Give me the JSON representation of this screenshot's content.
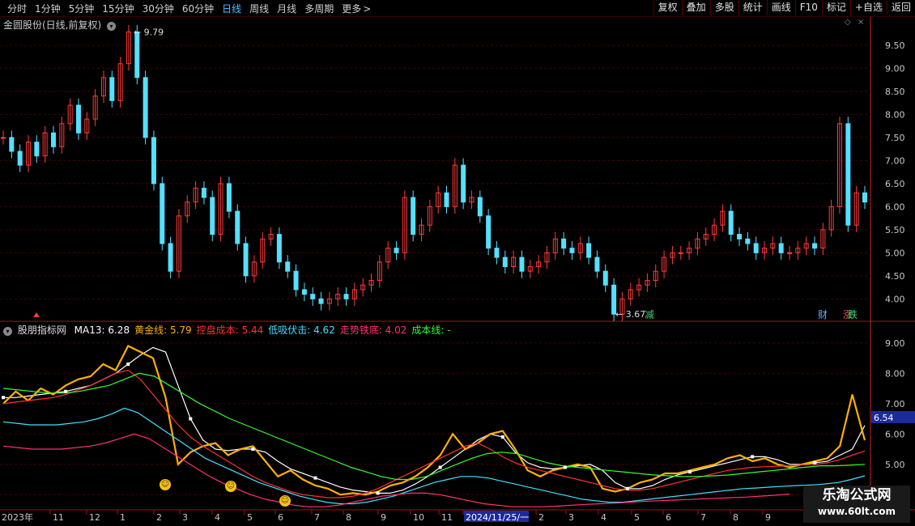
{
  "toolbar": {
    "periods": [
      "分时",
      "1分钟",
      "5分钟",
      "15分钟",
      "30分钟",
      "60分钟",
      "日线",
      "周线",
      "月线",
      "多周期",
      "更多"
    ],
    "active_period": "日线",
    "more_chevron_icon": "chevron-right-icon",
    "tools": [
      "复权",
      "叠加",
      "多股",
      "统计",
      "画线",
      "F10",
      "标记",
      "+自选",
      "返回"
    ]
  },
  "main_panel": {
    "title": "金圆股份(日线,前复权)",
    "high_label": "9.79",
    "low_label": "3.67",
    "markers": {
      "jian": "减",
      "cai": "财",
      "zhang": "涨",
      "die": "跌"
    },
    "colors": {
      "up": "#ff3b3b",
      "down": "#54e0ff",
      "grid": "#4a0000",
      "axis": "#cc2222"
    }
  },
  "indicator_panel": {
    "title": "股朋指标网",
    "items": [
      {
        "label": "MA13: 6.28",
        "color": "#ffffff"
      },
      {
        "label": "黄金线: 5.79",
        "color": "#ffb000"
      },
      {
        "label": "控盘成本: 5.44",
        "color": "#ff3030"
      },
      {
        "label": "低吸伏击: 4.62",
        "color": "#40e0ff"
      },
      {
        "label": "走势铁底: 4.02",
        "color": "#ff3070"
      },
      {
        "label": "成本线: -",
        "color": "#30ff30"
      }
    ],
    "current_value_label": "6.54",
    "smiley_icon": "smiley-icon",
    "smiley_count": 3
  },
  "x_axis": {
    "labels": [
      "2023年",
      "11",
      "12",
      "1",
      "2",
      "3",
      "4",
      "5",
      "6",
      "7",
      "8",
      "9",
      "10",
      "11",
      "2024/11/25/一",
      "2",
      "3",
      "4",
      "5",
      "6",
      "7",
      "8",
      "9"
    ]
  },
  "watermark": {
    "line1": "乐淘公式网",
    "line2": "www.60lt.com"
  },
  "chart_data": [
    {
      "type": "candlestick",
      "title": "金圆股份(日线,前复权)",
      "y_ticks": [
        4.0,
        4.5,
        5.0,
        5.5,
        6.0,
        6.5,
        7.0,
        7.5,
        8.0,
        8.5,
        9.0,
        9.5
      ],
      "ylim": [
        3.55,
        9.85
      ],
      "grid": true,
      "annotations": [
        {
          "text": "9.79",
          "type": "high"
        },
        {
          "text": "3.67",
          "type": "low"
        }
      ],
      "close_series": [
        7.5,
        7.2,
        6.9,
        7.4,
        7.1,
        7.6,
        7.3,
        7.8,
        8.2,
        7.6,
        7.9,
        8.4,
        8.8,
        8.3,
        9.1,
        9.79,
        8.8,
        7.5,
        6.5,
        5.2,
        4.6,
        5.8,
        6.1,
        6.4,
        6.2,
        5.4,
        6.5,
        5.9,
        5.2,
        4.5,
        4.8,
        5.3,
        5.4,
        4.8,
        4.6,
        4.2,
        4.1,
        4.0,
        3.9,
        4.0,
        4.1,
        4.0,
        4.2,
        4.3,
        4.4,
        4.8,
        5.1,
        5.0,
        6.2,
        5.4,
        5.6,
        6.0,
        6.3,
        6.0,
        6.9,
        6.1,
        6.2,
        5.8,
        5.1,
        4.9,
        4.7,
        4.9,
        4.6,
        4.7,
        4.8,
        5.0,
        5.3,
        5.1,
        5.0,
        5.2,
        4.9,
        4.6,
        4.3,
        3.67,
        4.0,
        4.2,
        4.3,
        4.4,
        4.6,
        4.9,
        5.0,
        5.0,
        5.1,
        5.3,
        5.4,
        5.6,
        5.9,
        5.4,
        5.3,
        5.2,
        5.0,
        5.1,
        5.2,
        5.0,
        5.0,
        5.1,
        5.2,
        5.1,
        5.5,
        6.0,
        7.8,
        5.6,
        6.3,
        6.1
      ]
    },
    {
      "type": "line",
      "title": "股朋指标网",
      "y_ticks": [
        4.0,
        5.0,
        6.0,
        7.0,
        8.0,
        9.0
      ],
      "ylim": [
        3.9,
        9.5
      ],
      "series": [
        {
          "name": "MA13",
          "color": "#ffffff",
          "values": [
            7.2,
            7.2,
            7.25,
            7.3,
            7.35,
            7.4,
            7.5,
            7.6,
            7.8,
            8.0,
            8.3,
            8.6,
            8.85,
            8.7,
            7.6,
            6.5,
            5.8,
            5.5,
            5.45,
            5.5,
            5.5,
            5.4,
            5.1,
            4.85,
            4.7,
            4.55,
            4.4,
            4.25,
            4.15,
            4.1,
            4.05,
            4.05,
            4.15,
            4.35,
            4.6,
            4.9,
            5.2,
            5.5,
            5.8,
            6.0,
            5.9,
            5.4,
            5.05,
            4.9,
            4.85,
            4.9,
            4.95,
            5.0,
            4.8,
            4.4,
            4.2,
            4.2,
            4.3,
            4.5,
            4.65,
            4.75,
            4.85,
            4.95,
            5.05,
            5.15,
            5.25,
            5.25,
            5.15,
            5.0,
            5.0,
            5.05,
            5.1,
            5.3,
            5.5,
            6.28
          ]
        },
        {
          "name": "黄金线",
          "color": "#ffb000",
          "values": [
            7.0,
            7.4,
            7.1,
            7.5,
            7.3,
            7.6,
            7.8,
            7.9,
            8.3,
            8.1,
            8.9,
            8.7,
            8.5,
            7.2,
            5.0,
            5.4,
            5.6,
            5.7,
            5.3,
            5.5,
            5.6,
            5.1,
            4.6,
            4.8,
            4.5,
            4.3,
            4.2,
            4.0,
            4.05,
            4.0,
            4.1,
            4.3,
            4.4,
            4.6,
            4.9,
            5.3,
            6.0,
            5.5,
            5.7,
            6.0,
            6.1,
            5.5,
            4.8,
            4.6,
            4.8,
            4.9,
            5.0,
            4.9,
            4.2,
            4.1,
            4.2,
            4.4,
            4.5,
            4.7,
            4.7,
            4.8,
            4.9,
            5.0,
            5.2,
            5.3,
            5.1,
            5.2,
            5.0,
            4.9,
            5.0,
            5.1,
            5.2,
            5.6,
            7.3,
            5.79
          ]
        },
        {
          "name": "控盘成本",
          "color": "#ff3030",
          "values": [
            7.0,
            7.05,
            7.1,
            7.15,
            7.2,
            7.3,
            7.45,
            7.6,
            7.8,
            8.0,
            8.1,
            7.8,
            7.3,
            6.8,
            6.3,
            5.9,
            5.6,
            5.35,
            5.1,
            4.85,
            4.6,
            4.4,
            4.25,
            4.1,
            4.0,
            3.95,
            3.9,
            3.9,
            3.95,
            4.05,
            4.2,
            4.4,
            4.6,
            4.8,
            5.0,
            5.2,
            5.4,
            5.6,
            5.7,
            5.5,
            5.25,
            5.05,
            4.9,
            4.8,
            4.7,
            4.6,
            4.5,
            4.4,
            4.3,
            4.2,
            4.15,
            4.15,
            4.2,
            4.3,
            4.4,
            4.5,
            4.6,
            4.7,
            4.8,
            4.85,
            4.9,
            4.92,
            4.94,
            4.95,
            4.98,
            5.0,
            5.05,
            5.15,
            5.3,
            5.44
          ]
        },
        {
          "name": "低吸伏击",
          "color": "#40e0ff",
          "values": [
            6.4,
            6.35,
            6.3,
            6.3,
            6.3,
            6.35,
            6.4,
            6.5,
            6.65,
            6.85,
            6.7,
            6.4,
            6.1,
            5.8,
            5.5,
            5.2,
            5.0,
            4.8,
            4.6,
            4.4,
            4.25,
            4.1,
            3.95,
            3.85,
            3.75,
            3.7,
            3.7,
            3.75,
            3.85,
            3.95,
            4.1,
            4.25,
            4.4,
            4.5,
            4.6,
            4.6,
            4.55,
            4.45,
            4.35,
            4.25,
            4.15,
            4.05,
            3.95,
            3.85,
            3.8,
            3.75,
            3.75,
            3.8,
            3.85,
            3.9,
            3.95,
            4.0,
            4.05,
            4.1,
            4.15,
            4.2,
            4.22,
            4.25,
            4.28,
            4.3,
            4.32,
            4.35,
            4.4,
            4.5,
            4.62
          ]
        },
        {
          "name": "走势铁底",
          "color": "#ff3070",
          "values": [
            5.6,
            5.55,
            5.5,
            5.5,
            5.5,
            5.55,
            5.6,
            5.7,
            5.85,
            6.0,
            5.85,
            5.55,
            5.25,
            4.95,
            4.65,
            4.4,
            4.2,
            4.0,
            3.85,
            3.75,
            3.65,
            3.6,
            3.6,
            3.65,
            3.75,
            3.85,
            3.95,
            4.0,
            4.05,
            4.05,
            4.0,
            3.9,
            3.8,
            3.7,
            3.65,
            3.6,
            3.6,
            3.6,
            3.62,
            3.65,
            3.68,
            3.7,
            3.72,
            3.75,
            3.78,
            3.8,
            3.82,
            3.84,
            3.86,
            3.88,
            3.9,
            3.92,
            3.95,
            3.98,
            4.02
          ]
        },
        {
          "name": "成本线",
          "color": "#30ff30",
          "values": [
            7.5,
            7.45,
            7.4,
            7.35,
            7.35,
            7.4,
            7.5,
            7.6,
            7.8,
            8.0,
            7.9,
            7.6,
            7.3,
            7.0,
            6.75,
            6.5,
            6.3,
            6.1,
            5.9,
            5.7,
            5.5,
            5.3,
            5.1,
            4.9,
            4.75,
            4.6,
            4.5,
            4.5,
            4.6,
            4.8,
            5.0,
            5.2,
            5.35,
            5.4,
            5.35,
            5.2,
            5.05,
            4.95,
            4.9,
            4.85,
            4.8,
            4.75,
            4.7,
            4.65,
            4.62,
            4.6,
            4.6,
            4.62,
            4.65,
            4.7,
            4.75,
            4.8,
            4.85,
            4.9,
            4.95,
            4.95,
            4.97,
            5.0
          ]
        }
      ]
    }
  ]
}
